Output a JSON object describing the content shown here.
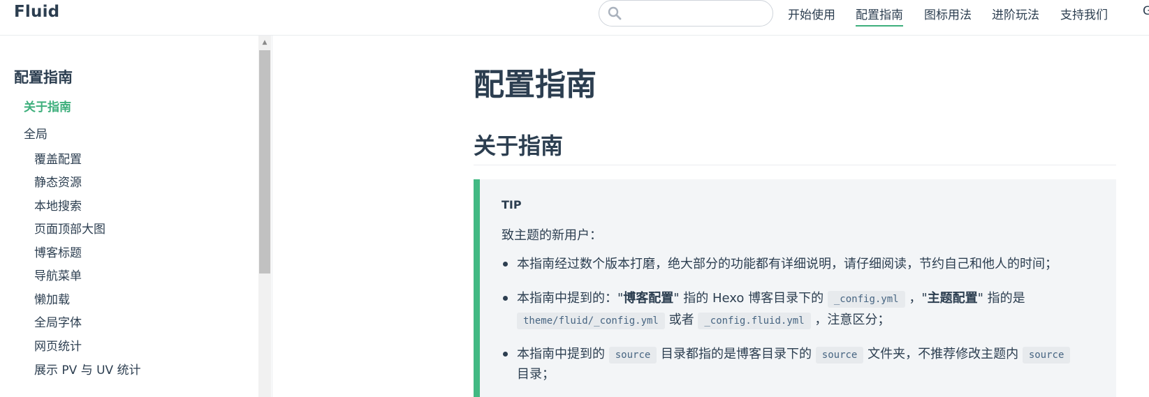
{
  "brand": "Fluid",
  "search": {
    "placeholder": "",
    "value": ""
  },
  "nav": {
    "items": [
      "开始使用",
      "配置指南",
      "图标用法",
      "进阶玩法",
      "支持我们"
    ],
    "active_index": 1,
    "extra_glyph": "G"
  },
  "sidebar": {
    "title": "配置指南",
    "items": [
      {
        "label": "关于指南",
        "active": true
      },
      {
        "label": "全局"
      },
      {
        "label": "覆盖配置"
      },
      {
        "label": "静态资源"
      },
      {
        "label": "本地搜索"
      },
      {
        "label": "页面顶部大图"
      },
      {
        "label": "博客标题"
      },
      {
        "label": "导航菜单"
      },
      {
        "label": "懒加载"
      },
      {
        "label": "全局字体"
      },
      {
        "label": "网页统计"
      },
      {
        "label": "展示 PV 与 UV 统计"
      }
    ]
  },
  "main": {
    "h1": "配置指南",
    "h2": "关于指南",
    "tip": {
      "title": "TIP",
      "intro": "致主题的新用户：",
      "li1": "本指南经过数个版本打磨，绝大部分的功能都有详细说明，请仔细阅读，节约自己和他人的时间；",
      "li2": {
        "a": "本指南中提到的：\"",
        "b": "博客配置",
        "c": "\" 指的 Hexo 博客目录下的",
        "code1": "_config.yml",
        "d": "，\"",
        "e": "主题配置",
        "f": "\" 指的是",
        "code2": "theme/fluid/_config.yml",
        "g": "或者",
        "code3": "_config.fluid.yml",
        "h": "，注意区分；"
      },
      "li3": {
        "a": "本指南中提到的",
        "code1": "source",
        "b": "目录都指的是博客目录下的",
        "code2": "source",
        "c": "文件夹，不推荐修改主题内",
        "code3": "source",
        "d": "目录；"
      }
    }
  },
  "colors": {
    "accent": "#3eaf7c",
    "tip_border": "#42b983",
    "tip_bg": "#f3f5f7",
    "text": "#2c3e50"
  }
}
